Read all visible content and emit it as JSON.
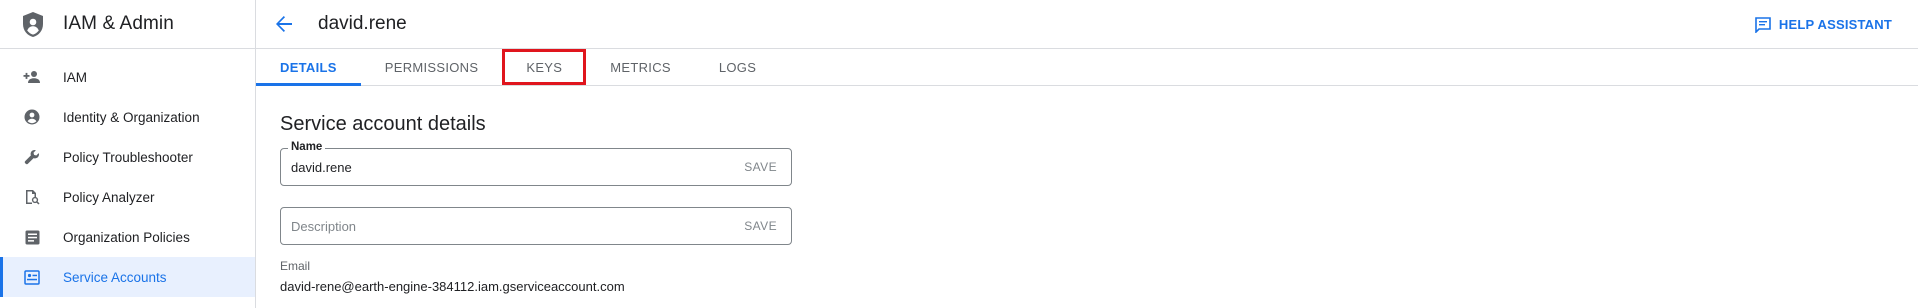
{
  "sidebar": {
    "title": "IAM & Admin",
    "items": [
      {
        "label": "IAM",
        "icon": "person-add-icon"
      },
      {
        "label": "Identity & Organization",
        "icon": "account-circle-icon"
      },
      {
        "label": "Policy Troubleshooter",
        "icon": "wrench-icon"
      },
      {
        "label": "Policy Analyzer",
        "icon": "document-search-icon"
      },
      {
        "label": "Organization Policies",
        "icon": "list-document-icon"
      },
      {
        "label": "Service Accounts",
        "icon": "service-account-icon",
        "active": true
      }
    ]
  },
  "header": {
    "title": "david.rene",
    "help_label": "HELP ASSISTANT"
  },
  "tabs": [
    {
      "label": "DETAILS",
      "active": true
    },
    {
      "label": "PERMISSIONS"
    },
    {
      "label": "KEYS",
      "highlighted": true
    },
    {
      "label": "METRICS"
    },
    {
      "label": "LOGS"
    }
  ],
  "details": {
    "section_title": "Service account details",
    "name_label": "Name",
    "name_value": "david.rene",
    "name_save": "SAVE",
    "description_placeholder": "Description",
    "description_save": "SAVE",
    "email_label": "Email",
    "email_value": "david-rene@earth-engine-384112.iam.gserviceaccount.com"
  },
  "colors": {
    "accent": "#1a73e8",
    "highlight": "#e0151d"
  }
}
